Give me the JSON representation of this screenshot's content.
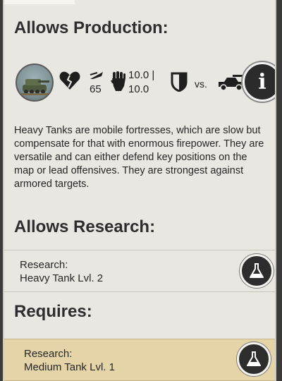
{
  "production": {
    "title": "Allows Production:",
    "stats": {
      "cost": "65",
      "attack_top": "10.0 |",
      "attack_bottom": "10.0",
      "vs_label": "vs."
    },
    "info_icon": "info-icon",
    "description": "Heavy Tanks are mobile fortresses, which are slow but compensate for that with enormous firepower. They are versatile and can either defend key positions on the map or lead offensives. They are strongest against armored targets."
  },
  "research": {
    "title": "Allows Research:",
    "item": {
      "line1": "Research:",
      "line2": "Heavy Tank Lvl. 2"
    }
  },
  "requires": {
    "title": "Requires:",
    "item": {
      "line1": "Research:",
      "line2": "Medium Tank Lvl. 1"
    }
  },
  "colors": {
    "panel": "#e9e7e1",
    "highlight_row": "#e6d4a9",
    "button_dark": "#2b2b2b"
  }
}
